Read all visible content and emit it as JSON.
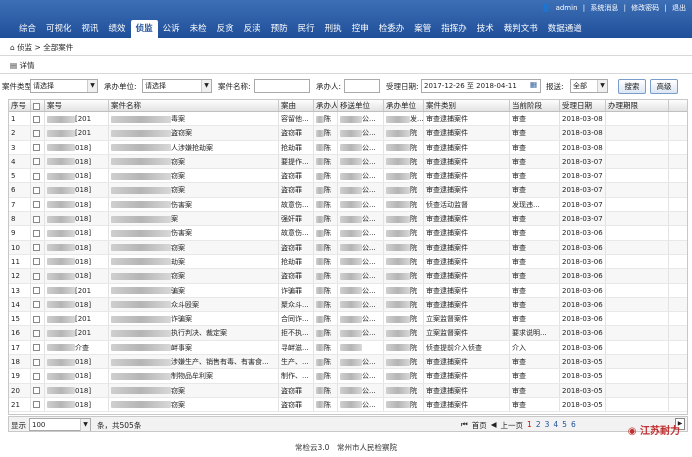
{
  "util": {
    "user": "admin",
    "msg": "系统消息",
    "pwd": "修改密码",
    "logout": "退出"
  },
  "nav": [
    "综合",
    "可视化",
    "视讯",
    "绩效",
    "侦监",
    "公诉",
    "未检",
    "反贪",
    "反渎",
    "预防",
    "民行",
    "刑执",
    "控申",
    "检委办",
    "案管",
    "指挥办",
    "技术",
    "裁判文书",
    "数据通道"
  ],
  "nav_active": 4,
  "crumb": "侦监 > 全部案件",
  "detail": "详情",
  "filters": {
    "type_label": "案件类型:",
    "type_val": "请选择",
    "unit_label": "承办单位:",
    "unit_val": "请选择",
    "name_label": "案件名称:",
    "person_label": "承办人:",
    "date_label": "受理日期:",
    "date_val": "2017-12-26 至 2018-04-11",
    "report_label": "报送:",
    "report_val": "全部",
    "search": "搜索",
    "advanced": "高级"
  },
  "columns": [
    "序号",
    "",
    "案号",
    "案件名称",
    "案由",
    "承办人",
    "移送单位",
    "承办单位",
    "案件类别",
    "当前阶段",
    "受理日期",
    "办理期限"
  ],
  "rows": [
    {
      "n": "1",
      "case_no": "[201",
      "name": "毒案",
      "reason": "容留他...",
      "person": "陈",
      "from": "公...",
      "unit": "发...",
      "cat": "审查逮捕案件",
      "stage": "审查",
      "date": "2018-03-08"
    },
    {
      "n": "2",
      "case_no": "[201",
      "name": "盗窃案",
      "reason": "盗窃罪",
      "person": "陈",
      "from": "公...",
      "unit": "院",
      "cat": "审查逮捕案件",
      "stage": "审查",
      "date": "2018-03-08"
    },
    {
      "n": "3",
      "case_no": "018]",
      "name": "人涉嫌抢劫案",
      "reason": "抢劫罪",
      "person": "陈",
      "from": "公...",
      "unit": "院",
      "cat": "审查逮捕案件",
      "stage": "审查",
      "date": "2018-03-08"
    },
    {
      "n": "4",
      "case_no": "018]",
      "name": "窃案",
      "reason": "要提作...",
      "person": "陈",
      "from": "公...",
      "unit": "院",
      "cat": "审查逮捕案件",
      "stage": "审查",
      "date": "2018-03-07"
    },
    {
      "n": "5",
      "case_no": "018]",
      "name": "窃案",
      "reason": "盗窃罪",
      "person": "陈",
      "from": "公...",
      "unit": "院",
      "cat": "审查逮捕案件",
      "stage": "审查",
      "date": "2018-03-07"
    },
    {
      "n": "6",
      "case_no": "018]",
      "name": "窃案",
      "reason": "盗窃罪",
      "person": "陈",
      "from": "公...",
      "unit": "院",
      "cat": "审查逮捕案件",
      "stage": "审查",
      "date": "2018-03-07"
    },
    {
      "n": "7",
      "case_no": "018]",
      "name": "伤害案",
      "reason": "故意伤...",
      "person": "陈",
      "from": "公...",
      "unit": "院",
      "cat": "侦查活动监督",
      "stage": "发现违...",
      "date": "2018-03-07"
    },
    {
      "n": "8",
      "case_no": "018]",
      "name": "案",
      "reason": "强奸罪",
      "person": "陈",
      "from": "公...",
      "unit": "院",
      "cat": "审查逮捕案件",
      "stage": "审查",
      "date": "2018-03-07"
    },
    {
      "n": "9",
      "case_no": "018]",
      "name": "伤害案",
      "reason": "故意伤...",
      "person": "陈",
      "from": "公...",
      "unit": "院",
      "cat": "审查逮捕案件",
      "stage": "审查",
      "date": "2018-03-06"
    },
    {
      "n": "10",
      "case_no": "018]",
      "name": "窃案",
      "reason": "盗窃罪",
      "person": "陈",
      "from": "公...",
      "unit": "院",
      "cat": "审查逮捕案件",
      "stage": "审查",
      "date": "2018-03-06"
    },
    {
      "n": "11",
      "case_no": "018]",
      "name": "劫案",
      "reason": "抢劫罪",
      "person": "陈",
      "from": "公...",
      "unit": "院",
      "cat": "审查逮捕案件",
      "stage": "审查",
      "date": "2018-03-06"
    },
    {
      "n": "12",
      "case_no": "018]",
      "name": "窃案",
      "reason": "盗窃罪",
      "person": "陈",
      "from": "公...",
      "unit": "院",
      "cat": "审查逮捕案件",
      "stage": "审查",
      "date": "2018-03-06"
    },
    {
      "n": "13",
      "case_no": "[201",
      "name": "骗案",
      "reason": "诈骗罪",
      "person": "陈",
      "from": "公...",
      "unit": "院",
      "cat": "审查逮捕案件",
      "stage": "审查",
      "date": "2018-03-06"
    },
    {
      "n": "14",
      "case_no": "018]",
      "name": "众斗殴案",
      "reason": "聚众斗...",
      "person": "陈",
      "from": "公...",
      "unit": "院",
      "cat": "审查逮捕案件",
      "stage": "审查",
      "date": "2018-03-06"
    },
    {
      "n": "15",
      "case_no": "[201",
      "name": "诈骗案",
      "reason": "合同诈...",
      "person": "陈",
      "from": "公...",
      "unit": "院",
      "cat": "立案监督案件",
      "stage": "审查",
      "date": "2018-03-06"
    },
    {
      "n": "16",
      "case_no": "[201",
      "name": "执行判决、裁定案",
      "reason": "拒不执...",
      "person": "陈",
      "from": "公...",
      "unit": "院",
      "cat": "立案监督案件",
      "stage": "要求说明...",
      "date": "2018-03-06"
    },
    {
      "n": "17",
      "case_no": "介查",
      "name": "衅事案",
      "reason": "寻衅滋...",
      "person": "陈",
      "from": "",
      "unit": "院",
      "cat": "侦查提前介入侦查",
      "stage": "介入",
      "date": "2018-03-06"
    },
    {
      "n": "18",
      "case_no": "018]",
      "name": "涉嫌生产、销售有毒、有害食...",
      "reason": "生产、...",
      "person": "陈",
      "from": "公...",
      "unit": "院",
      "cat": "审查逮捕案件",
      "stage": "审查",
      "date": "2018-03-05"
    },
    {
      "n": "19",
      "case_no": "018]",
      "name": "制物品牟利案",
      "reason": "制作、...",
      "person": "陈",
      "from": "公...",
      "unit": "院",
      "cat": "审查逮捕案件",
      "stage": "审查",
      "date": "2018-03-05"
    },
    {
      "n": "20",
      "case_no": "018]",
      "name": "窃案",
      "reason": "盗窃罪",
      "person": "陈",
      "from": "公...",
      "unit": "院",
      "cat": "审查逮捕案件",
      "stage": "审查",
      "date": "2018-03-05"
    },
    {
      "n": "21",
      "case_no": "018]",
      "name": "窃案",
      "reason": "盗窃罪",
      "person": "陈",
      "from": "公...",
      "unit": "院",
      "cat": "审查逮捕案件",
      "stage": "审查",
      "date": "2018-03-05"
    }
  ],
  "pager": {
    "show_label": "显示",
    "page_size": "100",
    "total": "条，共505条",
    "first": "首页",
    "prev": "上一页",
    "pages": [
      "1",
      "2",
      "3",
      "4",
      "5",
      "6"
    ]
  },
  "footer": "常检云3.0　常州市人民检察院",
  "watermark": "江苏耐力"
}
